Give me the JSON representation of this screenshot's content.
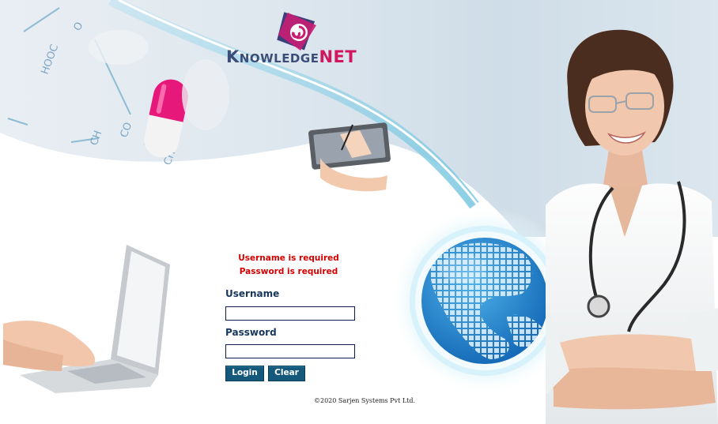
{
  "app": {
    "logo_text_first": "K",
    "logo_text_middle": "NOWLEDGE",
    "logo_text_brand": "NET"
  },
  "validation": {
    "username_error": "Username is required",
    "password_error": "Password is required"
  },
  "form": {
    "username_label": "Username",
    "username_value": "",
    "password_label": "Password",
    "password_value": "",
    "login_label": "Login",
    "clear_label": "Clear"
  },
  "footer": {
    "copyright": "©2020 Sarjen Systems Pvt Ltd."
  },
  "colors": {
    "error": "#d40000",
    "label": "#17365d",
    "button": "#14587c",
    "brand_pink": "#d1165f",
    "brand_navy": "#3c4d77"
  },
  "icons": {
    "logo_mark": "swirl-logo-icon",
    "globe": "globe-icon",
    "laptop": "laptop-icon",
    "nurse": "nurse-photo",
    "tablet": "tablet-icon"
  }
}
